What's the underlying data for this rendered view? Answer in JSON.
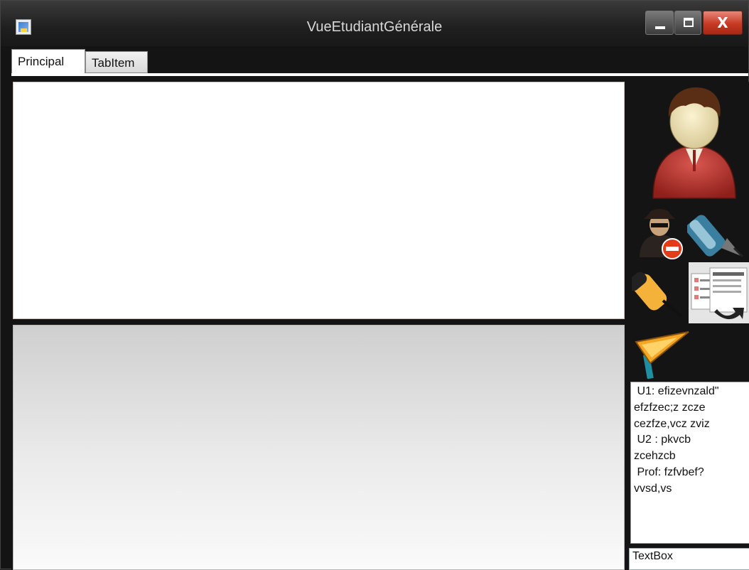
{
  "window": {
    "title": "VueEtudiantGénérale",
    "close_glyph": "X",
    "app_icon": "app-icon",
    "controls": [
      "minimize",
      "maximize",
      "close"
    ]
  },
  "tabs": [
    {
      "label": "Principal",
      "selected": true
    },
    {
      "label": "TabItem",
      "selected": false
    }
  ],
  "sidebar": {
    "icons": [
      "user-avatar-icon",
      "blocked-user-icon",
      "pen-icon",
      "marker-icon",
      "form-icon",
      "flag-icon"
    ]
  },
  "chat": {
    "lines": [
      " U1: efizevnzald\"",
      "efzfzec;z zcze",
      "cezfze,vcz zviz",
      " U2 : pkvcb",
      "zcehzcb",
      " Prof: fzfvbef?",
      "vvsd,vs"
    ]
  },
  "textbox": {
    "value": "TextBox"
  },
  "colors": {
    "close_red": "#c73a24",
    "titlebar": "#262626",
    "background": "#141414"
  }
}
